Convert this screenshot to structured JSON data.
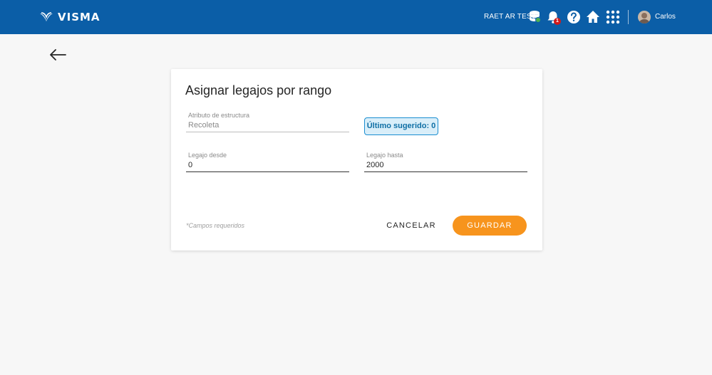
{
  "header": {
    "logo_text": "VISMA",
    "company_name": "RAET AR TEST",
    "notification_count": "1",
    "user_name": "Carlos",
    "icons": [
      "database-icon",
      "bell-icon",
      "help-icon",
      "home-icon",
      "apps-grid-icon"
    ]
  },
  "form": {
    "title": "Asignar legajos por rango",
    "structure_attribute": {
      "label": "Atributo de estructura",
      "value": "Recoleta"
    },
    "last_suggested": "Último sugerido: 0",
    "from": {
      "label": "Legajo desde",
      "value": "0"
    },
    "to": {
      "label": "Legajo hasta",
      "value": "2000"
    },
    "required_note": "*Campos requeridos",
    "cancel_label": "CANCELAR",
    "save_label": "GUARDAR"
  },
  "colors": {
    "brand": "#0b5ea7",
    "accent": "#f7941d",
    "info": "#1b8ed1"
  }
}
